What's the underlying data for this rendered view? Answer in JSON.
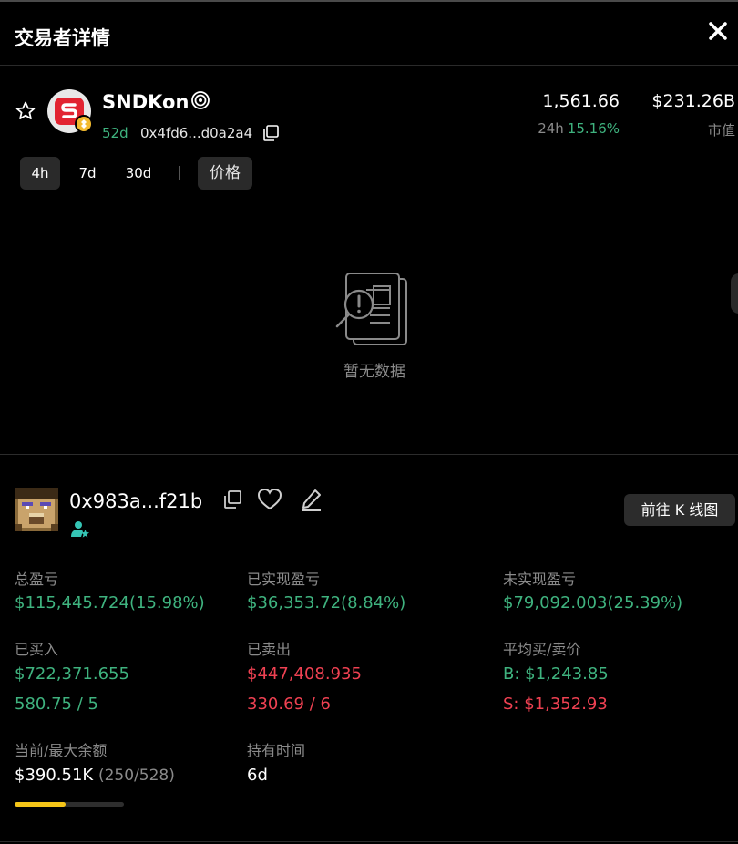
{
  "header": {
    "title": "交易者详情"
  },
  "token": {
    "name": "SNDKon",
    "age": "52d",
    "address": "0x4fd6...d0a2a4",
    "price": "1,561.66",
    "change_label": "24h",
    "change_value": "15.16%",
    "market_cap": "$231.26B",
    "market_cap_label": "市值"
  },
  "timeframes": [
    "4h",
    "7d",
    "30d"
  ],
  "active_timeframe": "4h",
  "price_button": "价格",
  "chart": {
    "empty_text": "暂无数据"
  },
  "trader": {
    "address": "0x983a...f21b",
    "kline_button": "前往 K 线图"
  },
  "stats": {
    "total_pnl": {
      "label": "总盈亏",
      "value": "$115,445.724(15.98%)"
    },
    "realized_pnl": {
      "label": "已实现盈亏",
      "value": "$36,353.72(8.84%)"
    },
    "unrealized_pnl": {
      "label": "未实现盈亏",
      "value": "$79,092.003(25.39%)"
    },
    "bought": {
      "label": "已买入",
      "value": "$722,371.655",
      "detail": "580.75 / 5"
    },
    "sold": {
      "label": "已卖出",
      "value": "$447,408.935",
      "detail": "330.69 / 6"
    },
    "avg_price": {
      "label": "平均买/卖价",
      "buy": "B: $1,243.85",
      "sell": "S: $1,352.93"
    },
    "balance": {
      "label": "当前/最大余额",
      "value": "$390.51K",
      "detail": "(250/528)",
      "ratio": 0.47
    },
    "hold_time": {
      "label": "持有时间",
      "value": "6d"
    }
  },
  "colors": {
    "positive": "#3fb37f",
    "negative": "#ef4152",
    "accent": "#f5c518"
  }
}
